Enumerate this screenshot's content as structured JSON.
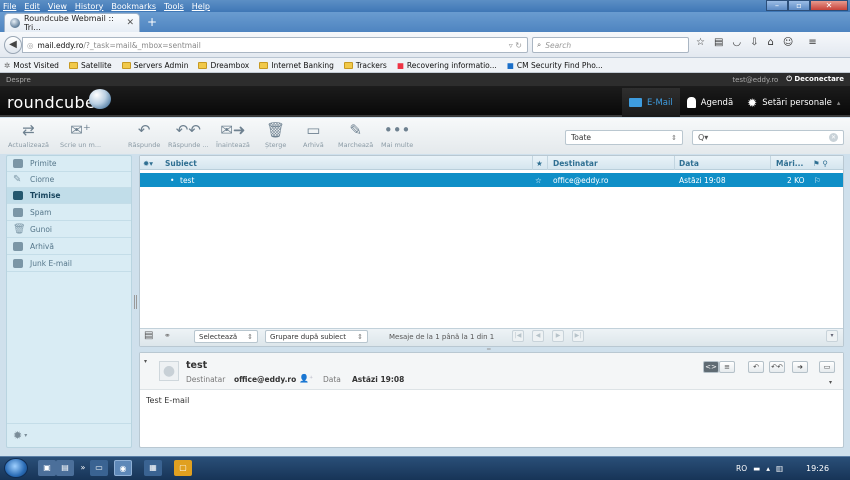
{
  "browser": {
    "menu": [
      "File",
      "Edit",
      "View",
      "History",
      "Bookmarks",
      "Tools",
      "Help"
    ],
    "tab_title": "Roundcube Webmail :: Tri...",
    "url_host": "mail.eddy.ro",
    "url_path": "/?_task=mail&_mbox=sentmail",
    "search_placeholder": "Search",
    "bookmarks": [
      "Most Visited",
      "Satellite",
      "Servers Admin",
      "Dreambox",
      "Internet Banking",
      "Trackers",
      "Recovering informatio...",
      "CM Security Find Pho..."
    ]
  },
  "rc": {
    "about": "Despre",
    "user": "test@eddy.ro",
    "logout": "Deconectare",
    "logo": "roundcube",
    "apps": {
      "mail": "E-Mail",
      "contacts": "Agendă",
      "settings": "Setări personale"
    },
    "toolbar": {
      "refresh": "Actualizează",
      "compose": "Scrie un m...",
      "reply": "Răspunde",
      "reply_all": "Răspunde ...",
      "forward": "Înaintează",
      "delete": "Șterge",
      "archive": "Arhivă",
      "mark": "Marchează",
      "more": "Mai multe"
    },
    "filter": "Toate",
    "quicksearch": "Q▾",
    "folders": [
      "Primite",
      "Ciorne",
      "Trimise",
      "Spam",
      "Gunoi",
      "Arhivă",
      "Junk E-mail"
    ],
    "selected_folder": "Trimise",
    "list_headers": {
      "subject": "Subiect",
      "to": "Destinatar",
      "date": "Data",
      "size": "Mări..."
    },
    "messages": [
      {
        "subject": "test",
        "to": "office@eddy.ro",
        "date": "Astăzi 19:08",
        "size": "2 KO"
      }
    ],
    "list_footer": {
      "select": "Selectează",
      "threads": "Grupare după subiect",
      "count": "Mesaje de la 1 până la 1 din 1"
    },
    "preview": {
      "subject": "test",
      "to_label": "Destinatar",
      "to": "office@eddy.ro",
      "date_label": "Data",
      "date": "Astăzi 19:08",
      "body": "Test E-mail"
    }
  },
  "taskbar": {
    "lang": "RO",
    "clock": "19:26"
  }
}
